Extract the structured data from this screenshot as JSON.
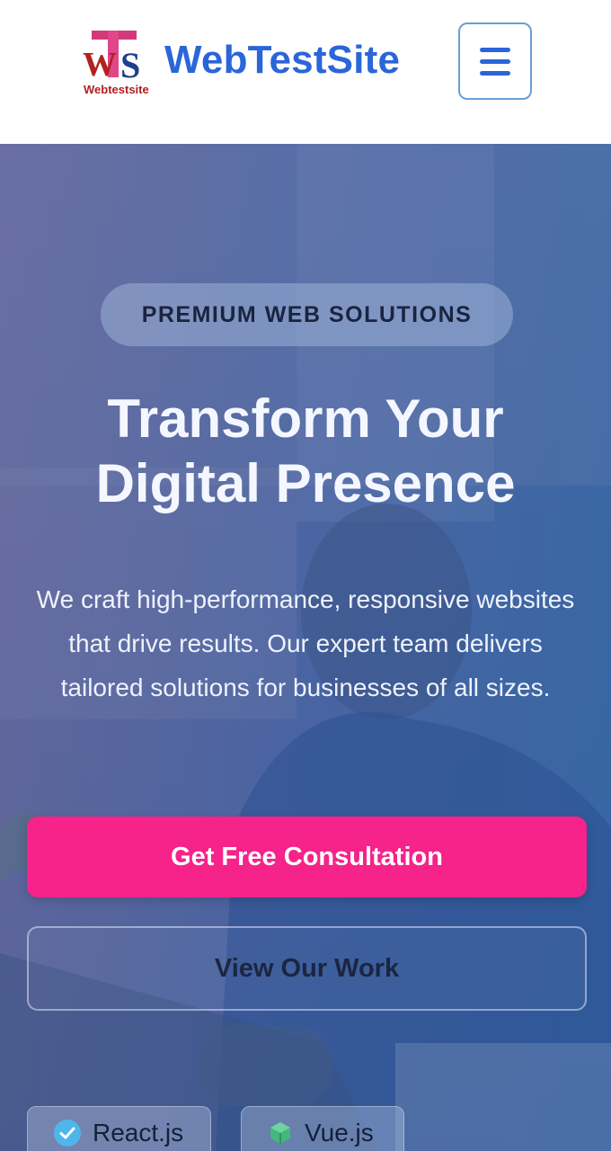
{
  "header": {
    "brand": "WebTestSite",
    "logo_text": "Webtestsite",
    "logo_letters": "WTS",
    "menu_icon": "hamburger-icon"
  },
  "hero": {
    "badge": "PREMIUM WEB SOLUTIONS",
    "headline_line1": "Transform Your",
    "headline_line2": "Digital Presence",
    "description": "We craft high-performance, responsive websites that drive results. Our expert team delivers tailored solutions for businesses of all sizes.",
    "primary_button": "Get Free Consultation",
    "secondary_button": "View Our Work",
    "tech_chips": [
      {
        "label": "React.js",
        "icon": "check-circle-icon"
      },
      {
        "label": "Vue.js",
        "icon": "vue-cube-icon"
      }
    ]
  },
  "colors": {
    "brand_blue": "#2a66d9",
    "cta_pink": "#f5238a",
    "hero_blue": "#3c6aa8"
  }
}
